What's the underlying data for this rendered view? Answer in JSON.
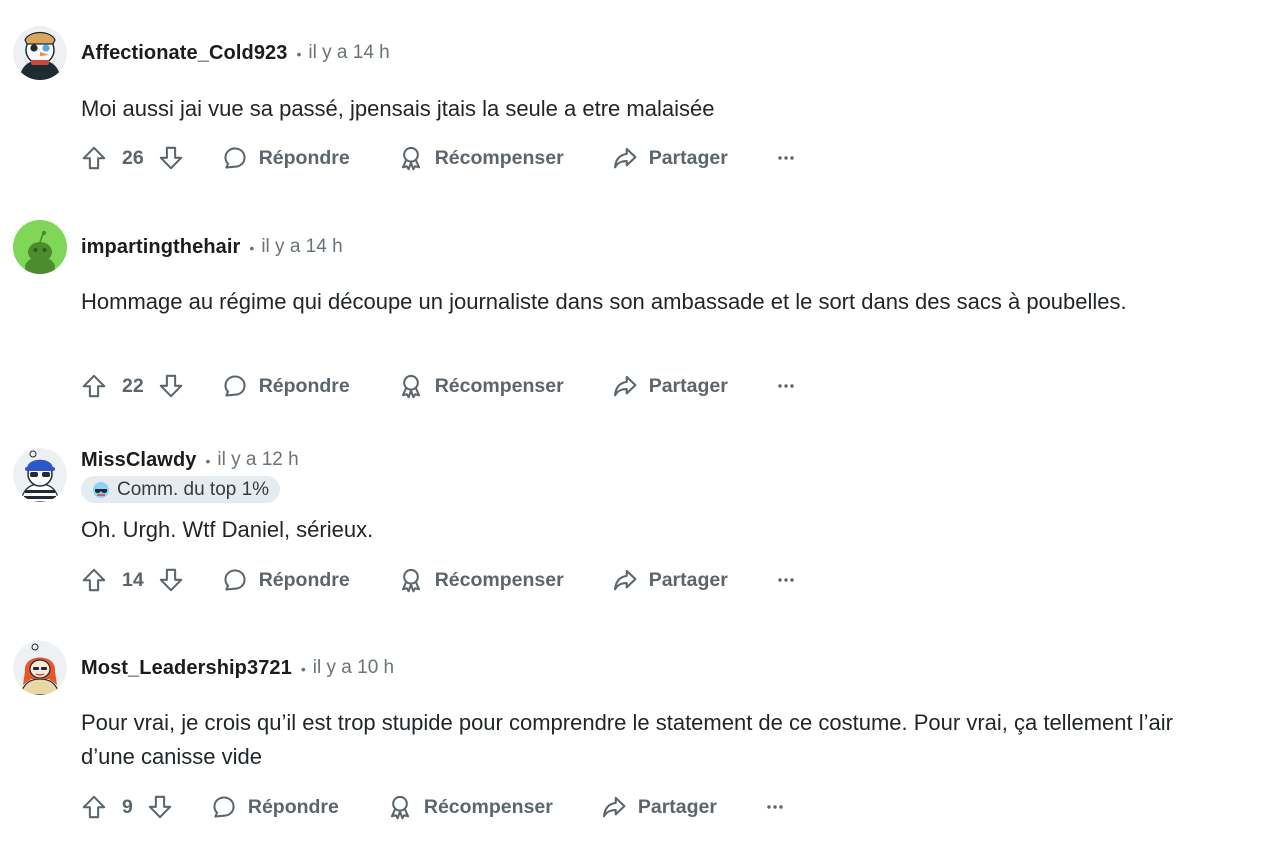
{
  "labels": {
    "reply": "Répondre",
    "award": "Récompenser",
    "share": "Partager"
  },
  "colors": {
    "text": "#1c1c1c",
    "muted": "#6a7378",
    "action": "#5b666c",
    "flair_bg": "#e5ebee"
  },
  "comments": [
    {
      "username": "Affectionate_Cold923",
      "time": "il y a 14 h",
      "body": "Moi aussi jai vue sa passé, jpensais jtais la seule a etre malaisée",
      "score": "26",
      "avatar": "snoo-avatar-snowman"
    },
    {
      "username": "impartingthehair",
      "time": "il y a 14 h",
      "body": "Hommage au régime qui découpe un journaliste dans son ambassade et le sort dans des sacs à poubelles.",
      "score": "22",
      "avatar": "snoo-avatar-green-default"
    },
    {
      "username": "MissClawdy",
      "time": "il y a 12 h",
      "flair": "Comm. du top 1%",
      "body": "Oh. Urgh. Wtf Daniel, sérieux.",
      "score": "14",
      "avatar": "snoo-avatar-blue-cap-sunglasses"
    },
    {
      "username": "Most_Leadership3721",
      "time": "il y a 10 h",
      "body": "Pour vrai, je crois qu’il est trop stupide pour comprendre le statement de ce costume. Pour vrai, ça tellement l’air d’une canisse vide",
      "score": "9",
      "avatar": "snoo-avatar-red-hair"
    }
  ]
}
